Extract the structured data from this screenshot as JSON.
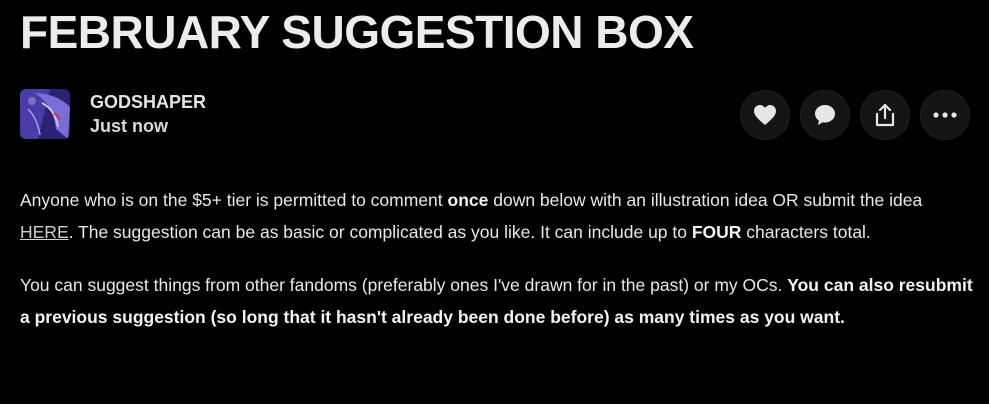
{
  "post": {
    "title": "FEBRUARY SUGGESTION BOX"
  },
  "author": {
    "name": "GODSHAPER",
    "time": "Just now",
    "avatar_colors": [
      "#3b2e8c",
      "#6a5cd0",
      "#b9b0ee",
      "#8a2a3a"
    ]
  },
  "actions": {
    "like_icon": "heart-icon",
    "comment_icon": "comment-icon",
    "share_icon": "share-icon",
    "more_icon": "more-icon"
  },
  "body": {
    "p1": {
      "t1": "Anyone who is on the $5+ tier is permitted to comment ",
      "b1": "once",
      "t2": " down below with an illustration idea OR submit the idea ",
      "link": "HERE",
      "t3": ". The suggestion can be as basic or complicated as you like. It can include up to ",
      "b2": "FOUR",
      "t4": " characters total."
    },
    "p2": {
      "t1": "You can suggest things from other fandoms (preferably ones I've drawn for in the past) or my OCs. ",
      "b1": "You can also resubmit a previous suggestion (so long that it hasn't already been done before) as many times as you want."
    }
  },
  "colors": {
    "background": "#000000",
    "text": "#e8e8e8",
    "button_bg": "#141414"
  }
}
